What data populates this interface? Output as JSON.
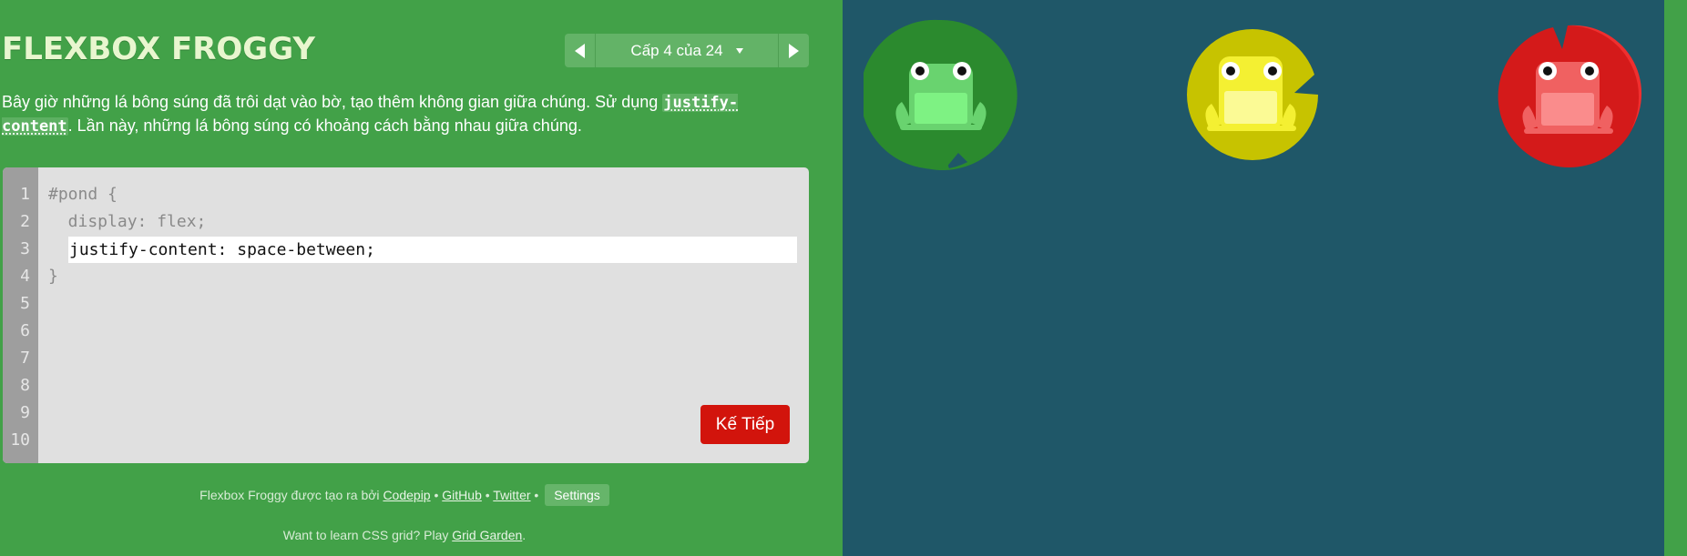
{
  "app": {
    "title": "FLEXBOX FROGGY"
  },
  "level_nav": {
    "level_label": "Cấp 4 của 24"
  },
  "instructions": {
    "part1": "Bây giờ những lá bông súng đã trôi dạt vào bờ, tạo thêm không gian giữa chúng. Sử dụng ",
    "code": "justify-content",
    "part2": ". Lần này, những lá bông súng có khoảng cách bằng nhau giữa chúng."
  },
  "editor": {
    "line_numbers": [
      "1",
      "2",
      "3",
      "4",
      "5",
      "6",
      "7",
      "8",
      "9",
      "10"
    ],
    "line1": "#pond {",
    "line2": "  display: flex;",
    "input_value": "justify-content: space-between;",
    "line4": "}",
    "next_label": "Kế Tiếp"
  },
  "footer": {
    "credit_prefix": "Flexbox Froggy được tạo ra bởi ",
    "codepip": "Codepip",
    "sep1": " • ",
    "github": "GitHub",
    "sep2": " • ",
    "twitter": "Twitter",
    "sep3": " • ",
    "settings": "Settings",
    "grid_prefix": "Want to learn CSS grid? Play ",
    "grid_link": "Grid Garden",
    "grid_suffix": "."
  },
  "pond": {
    "frogs": [
      {
        "color": "green",
        "pad": "#2b8a2e",
        "body": "#69d36f",
        "belly": "#7ef283"
      },
      {
        "color": "yellow",
        "pad": "#c7c300",
        "body": "#f4f032",
        "belly": "#fbfa95"
      },
      {
        "color": "red",
        "pad": "#d41a1a",
        "body": "#f06161",
        "belly": "#fa8c8c"
      }
    ]
  },
  "colors": {
    "sidebar_bg": "#42a148",
    "pond_bg": "#1f5768",
    "next_button": "#d2140c",
    "editor_bg": "#e0e0e0"
  }
}
